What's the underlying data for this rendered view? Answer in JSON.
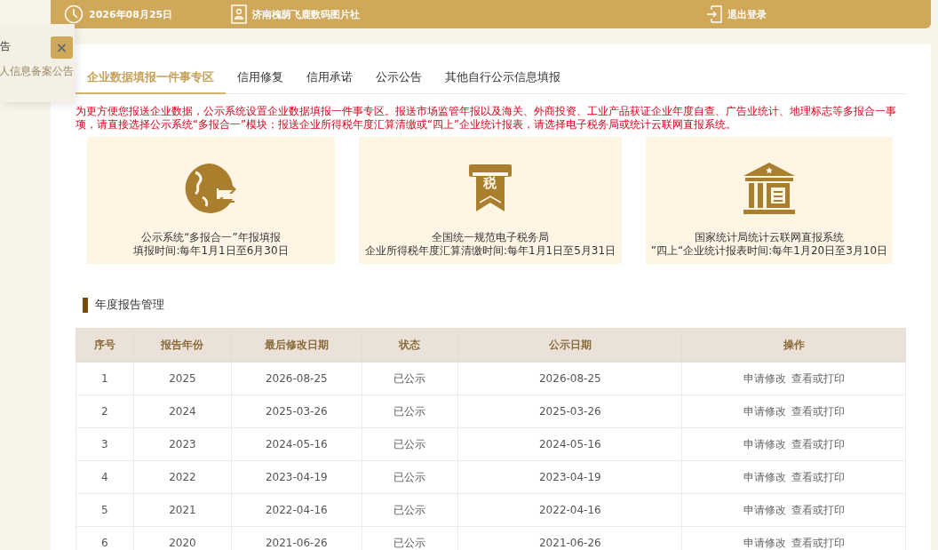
{
  "header": {
    "date": "2026年08月25日",
    "company": "济南槐荫飞鹿数码图片社",
    "logout": "退出登录"
  },
  "notice": {
    "title": "告",
    "text": "人信息备案公告",
    "close": "×"
  },
  "tabs": [
    {
      "label": "企业数据填报一件事专区",
      "selected": true
    },
    {
      "label": "信用修复",
      "selected": false
    },
    {
      "label": "信用承诺",
      "selected": false
    },
    {
      "label": "公示公告",
      "selected": false
    },
    {
      "label": "其他自行公示信息填报",
      "selected": false
    }
  ],
  "notice_text": "为更方便您报送企业数据，公示系统设置企业数据填报一件事专区。报送市场监管年报以及海关、外商投资、工业产品获证企业年度自查、广告业统计、地理标志等多报合一事项，请直接选择公示系统“多报合一”模块；报送企业所得税年度汇算清缴或“四上”企业统计报表，请选择电子税务局或统计云联网直报系统。",
  "cards": [
    {
      "kind": "globe",
      "title": "公示系统“多报合一”年报填报",
      "subtitle": "填报时间:每年1月1日至6月30日"
    },
    {
      "kind": "tax",
      "title": "全国统一规范电子税务局",
      "subtitle": "企业所得税年度汇算清缴时间:每年1月1日至5月31日",
      "badge": "税"
    },
    {
      "kind": "bank",
      "title": "国家统计局统计云联网直报系统",
      "subtitle": "”四上“企业统计报表时间:每年1月20日至3月10日"
    }
  ],
  "section_title": "年度报告管理",
  "table": {
    "columns": [
      "序号",
      "报告年份",
      "最后修改日期",
      "状态",
      "公示日期",
      "操作"
    ],
    "rows": [
      {
        "cells": [
          "1",
          "2025",
          "2026-08-25",
          "已公示",
          "2026-08-25"
        ],
        "actions": [
          "申请修改",
          "查看或打印"
        ]
      },
      {
        "cells": [
          "2",
          "2024",
          "2025-03-26",
          "已公示",
          "2025-03-26"
        ],
        "actions": [
          "申请修改",
          "查看或打印"
        ]
      },
      {
        "cells": [
          "3",
          "2023",
          "2024-05-16",
          "已公示",
          "2024-05-16"
        ],
        "actions": [
          "申请修改",
          "查看或打印"
        ]
      },
      {
        "cells": [
          "4",
          "2022",
          "2023-04-19",
          "已公示",
          "2023-04-19"
        ],
        "actions": [
          "申请修改",
          "查看或打印"
        ]
      },
      {
        "cells": [
          "5",
          "2021",
          "2022-04-16",
          "已公示",
          "2022-04-16"
        ],
        "actions": [
          "申请修改",
          "查看或打印"
        ]
      },
      {
        "cells": [
          "6",
          "2020",
          "2021-06-26",
          "已公示",
          "2021-06-26"
        ],
        "actions": [
          "申请修改",
          "查看或打印"
        ]
      }
    ]
  }
}
